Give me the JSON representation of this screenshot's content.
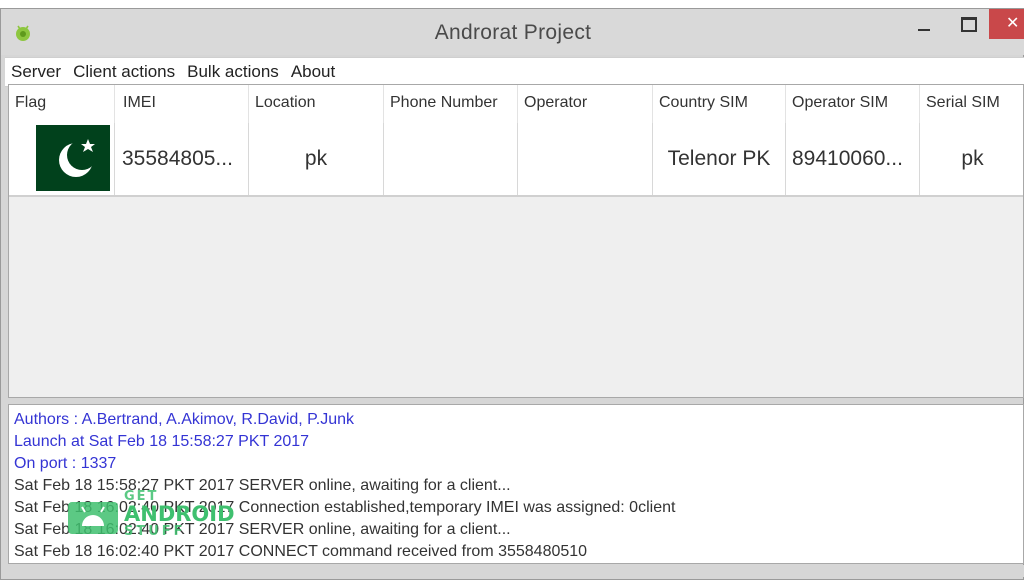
{
  "window": {
    "title": "Androrat Project"
  },
  "menu": [
    "Server",
    "Client actions",
    "Bulk actions",
    "About"
  ],
  "table": {
    "columns": [
      "Flag",
      "IMEI",
      "Location",
      "Phone Number",
      "Operator",
      "Country SIM",
      "Operator SIM",
      "Serial SIM"
    ],
    "rows": [
      {
        "flag": "pakistan-flag-icon",
        "imei": "35584805...",
        "location": "pk",
        "phone_number": "",
        "operator": "",
        "country_sim": "Telenor PK",
        "operator_sim": "89410060...",
        "serial_sim": "pk"
      }
    ]
  },
  "log": {
    "info": [
      "Authors : A.Bertrand, A.Akimov, R.David, P.Junk",
      "Launch at Sat Feb 18 15:58:27 PKT 2017",
      "On port : 1337"
    ],
    "events": [
      "Sat Feb 18 15:58:27 PKT 2017 SERVER online, awaiting for a client...",
      "Sat Feb 18 16:02:40 PKT 2017 Connection established,temporary IMEI was assigned: 0client",
      "Sat Feb 18 16:02:40 PKT 2017 SERVER online, awaiting for a client...",
      "Sat Feb 18 16:02:40 PKT 2017 CONNECT command received from 3558480510"
    ]
  },
  "watermark": {
    "line1": "GET",
    "line2": "ANDROID",
    "line3": "STUFF"
  },
  "colors": {
    "info_text": "#3434d4",
    "close_button": "#c9484a",
    "flag_green": "#01411c",
    "watermark_green": "#3fc06f"
  }
}
